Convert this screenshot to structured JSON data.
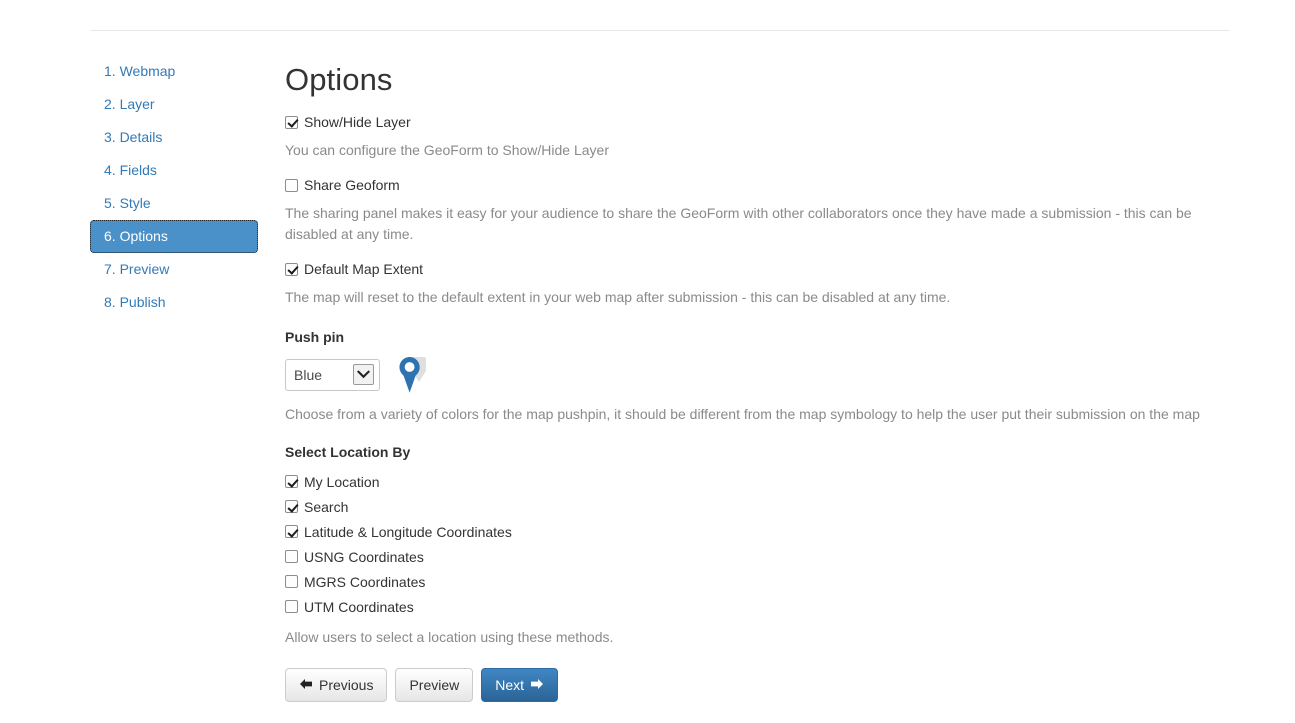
{
  "sidebar": {
    "items": [
      {
        "label": "1. Webmap",
        "active": false
      },
      {
        "label": "2. Layer",
        "active": false
      },
      {
        "label": "3. Details",
        "active": false
      },
      {
        "label": "4. Fields",
        "active": false
      },
      {
        "label": "5. Style",
        "active": true
      },
      {
        "label": "6. Options",
        "active": true
      },
      {
        "label": "7. Preview",
        "active": false
      },
      {
        "label": "8. Publish",
        "active": false
      }
    ]
  },
  "main": {
    "title": "Options",
    "show_hide_layer": {
      "label": "Show/Hide Layer",
      "checked": true,
      "help": "You can configure the GeoForm to Show/Hide Layer"
    },
    "share_geoform": {
      "label": "Share Geoform",
      "checked": false,
      "help": "The sharing panel makes it easy for your audience to share the GeoForm with other collaborators once they have made a submission - this can be disabled at any time."
    },
    "default_map_extent": {
      "label": "Default Map Extent",
      "checked": true,
      "help": "The map will reset to the default extent in your web map after submission - this can be disabled at any time."
    },
    "push_pin": {
      "label": "Push pin",
      "selected_color": "Blue",
      "options": [
        "Blue"
      ],
      "pin_icon": "map-pin-icon",
      "pin_color": "#2e73b0",
      "help": "Choose from a variety of colors for the map pushpin, it should be different from the map symbology to help the user put their submission on the map"
    },
    "select_location_by": {
      "label": "Select Location By",
      "options": [
        {
          "label": "My Location",
          "checked": true
        },
        {
          "label": "Search",
          "checked": true
        },
        {
          "label": "Latitude & Longitude Coordinates",
          "checked": true
        },
        {
          "label": "USNG Coordinates",
          "checked": false
        },
        {
          "label": "MGRS Coordinates",
          "checked": false
        },
        {
          "label": "UTM Coordinates",
          "checked": false
        }
      ],
      "help": "Allow users to select a location using these methods."
    },
    "buttons": {
      "previous": {
        "label": "Previous",
        "icon": "arrow-left-icon",
        "glyph": "⬅"
      },
      "preview": {
        "label": "Preview"
      },
      "next": {
        "label": "Next",
        "icon": "arrow-right-icon",
        "glyph": "➡"
      }
    }
  },
  "colors": {
    "link": "#337ab7",
    "active_nav_bg": "#4a90c9",
    "primary_button": "#2a6496",
    "help_text": "#8a8a8a"
  }
}
